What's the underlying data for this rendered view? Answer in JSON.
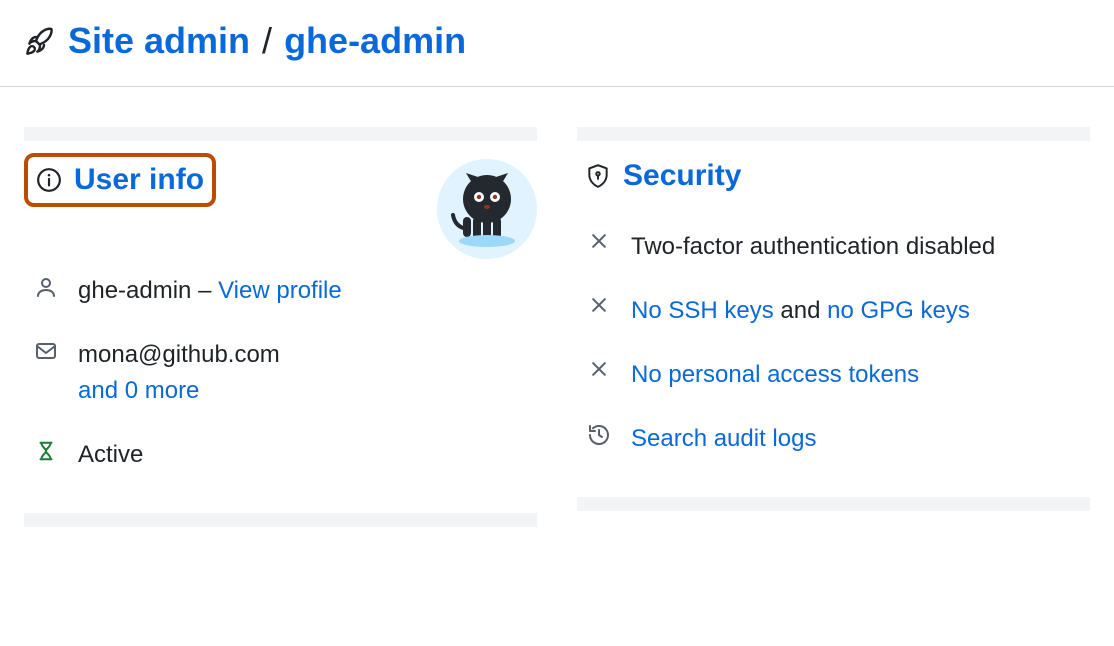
{
  "breadcrumb": {
    "root": "Site admin",
    "separator": "/",
    "current": "ghe-admin"
  },
  "panels": {
    "user_info": {
      "heading": "User info",
      "username": "ghe-admin",
      "dash": "–",
      "view_profile": "View profile",
      "email": "mona@github.com",
      "email_more": "and 0 more",
      "status": "Active"
    },
    "security": {
      "heading": "Security",
      "twofa": "Two-factor authentication disabled",
      "ssh_link": "No SSH keys",
      "and": "and",
      "gpg_link": "no GPG keys",
      "pat": "No personal access tokens",
      "audit": "Search audit logs"
    }
  }
}
